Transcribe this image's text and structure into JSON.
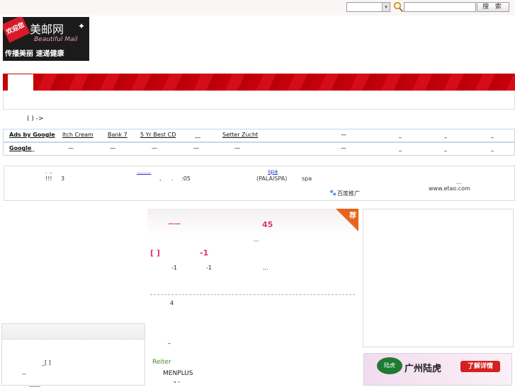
{
  "search": {
    "select_arrow": "▾",
    "button_label": "搜 索"
  },
  "logo": {
    "badge": "欢迎您",
    "name": "美邮网",
    "name_en": "Beautiful Mail",
    "tagline": "传播美丽 速递健康",
    "star": "✦"
  },
  "breadcrumb": "( ) ->",
  "ads_row1": {
    "label": "Ads by Google",
    "links": [
      "Itch Cream",
      "Bank 7",
      "5 Yr Best CD",
      "__",
      "Setter Zucht"
    ],
    "dashes": [
      "—",
      "_",
      "_",
      "_"
    ]
  },
  "ads_row2": {
    "label": "Google",
    "dashes": [
      "—",
      "—",
      "—",
      "—",
      "—",
      "—",
      "_",
      "_",
      "_"
    ]
  },
  "baidu_ads": {
    "t1": ". ..",
    "t2": "!!!",
    "t3": "3",
    "link1": "........",
    "t4": ",",
    "t5": ".",
    "t6": ":05",
    "link2": "spa",
    "t7": "(PALAISPA)",
    "t8": "spa",
    "t9": "...",
    "url": "www.etao.com",
    "brand": "百度推广"
  },
  "feature": {
    "badge": "荐",
    "headline_dash": "——",
    "headline_num": "45",
    "ellipsis": "...",
    "bracket": "[  ]",
    "minus1": "-1",
    "row_a": "-1",
    "row_b": "-1",
    "row_c": "...",
    "item_num": "4",
    "underscore": "_",
    "reiter": "Reiter",
    "menplus": "MENPLUS",
    "small_mark": "\" '"
  },
  "left_panel": {
    "bracket": "_[ ]",
    "dashes": "--",
    "line": "____"
  },
  "right_ad": {
    "logo_text": "陆虎",
    "title": "广州陆虎",
    "button": "了解详情"
  },
  "colors": {
    "banner_red": "#c4000b",
    "accent_pink": "#e0307a",
    "badge_orange": "#e8641c",
    "ad_link_blue": "#2233cc"
  }
}
